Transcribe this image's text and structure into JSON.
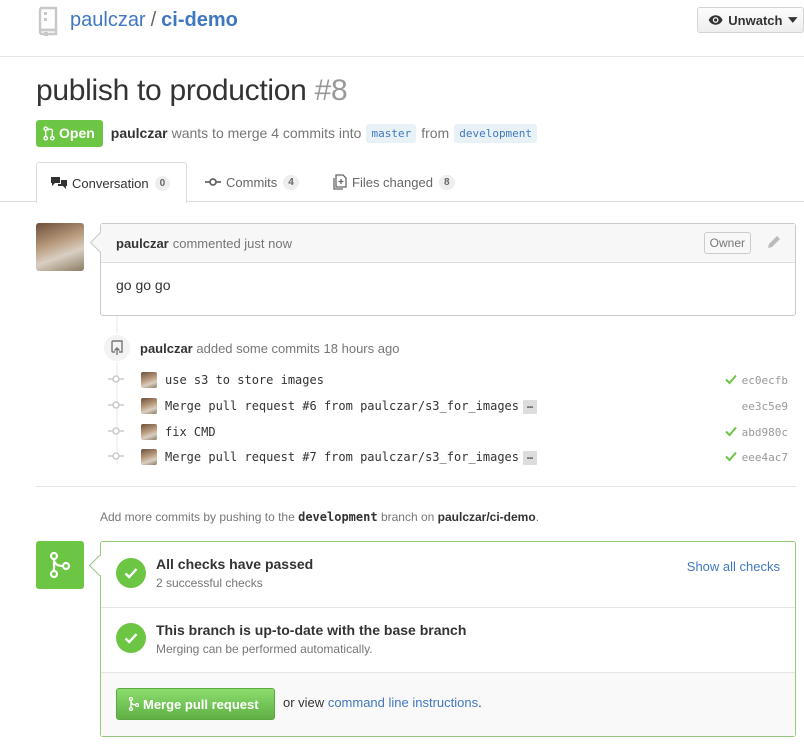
{
  "repo": {
    "owner": "paulczar",
    "separator": "/",
    "name": "ci-demo"
  },
  "watch_button": {
    "label": "Unwatch"
  },
  "pr": {
    "title": "publish to production",
    "number": "#8",
    "state": "Open",
    "author": "paulczar",
    "merge_text": "wants to merge 4 commits into",
    "base_branch": "master",
    "from_text": "from",
    "head_branch": "development"
  },
  "tabs": [
    {
      "label": "Conversation",
      "count": "0",
      "icon": "comment-discussion-icon"
    },
    {
      "label": "Commits",
      "count": "4",
      "icon": "git-commit-icon"
    },
    {
      "label": "Files changed",
      "count": "8",
      "icon": "diff-icon"
    }
  ],
  "comment": {
    "author": "paulczar",
    "action": "commented just now",
    "badge": "Owner",
    "body": "go go go"
  },
  "commits_event": {
    "author": "paulczar",
    "text": "added some commits 18 hours ago",
    "commits": [
      {
        "message": "use s3 to store images",
        "sha": "ec0ecfb",
        "status": "success",
        "truncated": false
      },
      {
        "message": "Merge pull request #6 from paulczar/s3_for_images",
        "sha": "ee3c5e9",
        "status": "none",
        "truncated": true
      },
      {
        "message": "fix CMD",
        "sha": "abd980c",
        "status": "success",
        "truncated": false
      },
      {
        "message": "Merge pull request #7 from paulczar/s3_for_images",
        "sha": "eee4ac7",
        "status": "success",
        "truncated": true
      }
    ],
    "ellipsis": "…"
  },
  "push_note": {
    "prefix": "Add more commits by pushing to the",
    "branch": "development",
    "middle": "branch on",
    "repo": "paulczar/ci-demo",
    "suffix": "."
  },
  "merge_box": {
    "checks_title": "All checks have passed",
    "checks_sub": "2 successful checks",
    "show_all": "Show all checks",
    "uptodate_title": "This branch is up-to-date with the base branch",
    "uptodate_sub": "Merging can be performed automatically.",
    "merge_button": "Merge pull request",
    "or_view": "or view",
    "cli_link": "command line instructions",
    "period": "."
  },
  "colors": {
    "link": "#4078c0",
    "success": "#6cc644",
    "text": "#333333",
    "muted": "#767676"
  }
}
